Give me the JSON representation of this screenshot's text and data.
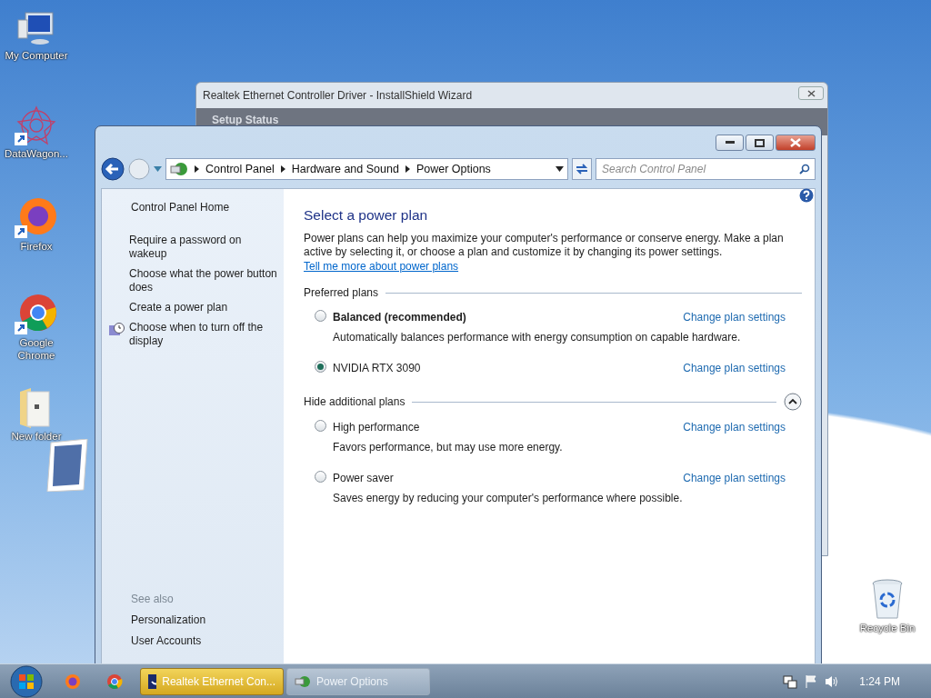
{
  "desktop_icons": [
    {
      "kind": "computer",
      "label": "My Computer"
    },
    {
      "kind": "star",
      "label": "DataWagon..."
    },
    {
      "kind": "firefox",
      "label": "Firefox"
    },
    {
      "kind": "chrome",
      "label": "Google Chrome"
    },
    {
      "kind": "folder",
      "label": "New folder"
    },
    {
      "kind": "recycle",
      "label": "Recycle Bin"
    }
  ],
  "background_window": {
    "title": "Realtek Ethernet Controller Driver - InstallShield Wizard",
    "section": "Setup Status"
  },
  "window": {
    "breadcrumb": [
      "Control Panel",
      "Hardware and Sound",
      "Power Options"
    ],
    "search": {
      "placeholder": "Search Control Panel"
    },
    "sidebar": {
      "home": "Control Panel Home",
      "tasks": [
        {
          "label": "Require a password on wakeup",
          "kind": "plain"
        },
        {
          "label": "Choose what the power button does",
          "kind": "plain"
        },
        {
          "label": "Create a power plan",
          "kind": "plain"
        },
        {
          "label": "Choose when to turn off the display",
          "kind": "display"
        }
      ],
      "see_also_title": "See also",
      "see_also": [
        "Personalization",
        "User Accounts"
      ]
    },
    "heading": "Select a power plan",
    "intro": "Power plans can help you maximize your computer's performance or conserve energy. Make a plan active by selecting it, or choose a plan and customize it by changing its power settings.",
    "intro_link": "Tell me more about power plans",
    "groups": [
      {
        "title": "Preferred plans",
        "plans": [
          {
            "name": "Balanced (recommended)",
            "recommended": true,
            "selected": false,
            "description": "Automatically balances performance with energy consumption on capable hardware.",
            "link": "Change plan settings"
          },
          {
            "name": "NVIDIA RTX 3090",
            "recommended": false,
            "selected": true,
            "link": "Change plan settings"
          }
        ]
      },
      {
        "title": "Hide additional plans",
        "expanded": true,
        "plans": [
          {
            "name": "High performance",
            "recommended": false,
            "selected": false,
            "description": "Favors performance, but may use more energy.",
            "link": "Change plan settings"
          },
          {
            "name": "Power saver",
            "recommended": false,
            "selected": false,
            "description": "Saves energy by reducing your computer's performance where possible.",
            "link": "Change plan settings"
          }
        ]
      }
    ]
  },
  "taskbar": {
    "tasks": [
      {
        "label": "Realtek Ethernet Con...",
        "kind": "installer",
        "highlighted": true
      },
      {
        "label": "Power Options",
        "kind": "control",
        "highlighted": false
      }
    ],
    "clock": "1:24 PM"
  }
}
